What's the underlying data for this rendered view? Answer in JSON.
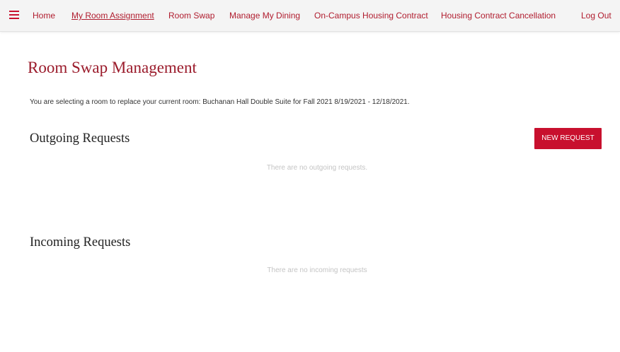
{
  "nav": {
    "menu_icon": "hamburger-menu-icon",
    "items": [
      {
        "label": "Home",
        "active": false
      },
      {
        "label": "My Room Assignment",
        "active": true
      },
      {
        "label": "Room Swap",
        "active": false
      },
      {
        "label": "Manage My Dining",
        "active": false
      },
      {
        "label": "On-Campus Housing Contract",
        "active": false
      },
      {
        "label": "Housing Contract Cancellation",
        "active": false
      }
    ],
    "logout_label": "Log Out"
  },
  "page": {
    "title": "Room Swap Management",
    "intro": "You are selecting a room to replace your current room: Buchanan Hall Double Suite for Fall 2021 8/19/2021 - 12/18/2021."
  },
  "outgoing": {
    "heading": "Outgoing Requests",
    "new_request_label": "NEW REQUEST",
    "empty_message": "There are no outgoing requests."
  },
  "incoming": {
    "heading": "Incoming Requests",
    "empty_message": "There are no incoming requests"
  },
  "colors": {
    "accent": "#c8102e",
    "title": "#9b1c2c",
    "nav_background": "#f4f4f4",
    "muted_text": "#c4c4c4"
  }
}
